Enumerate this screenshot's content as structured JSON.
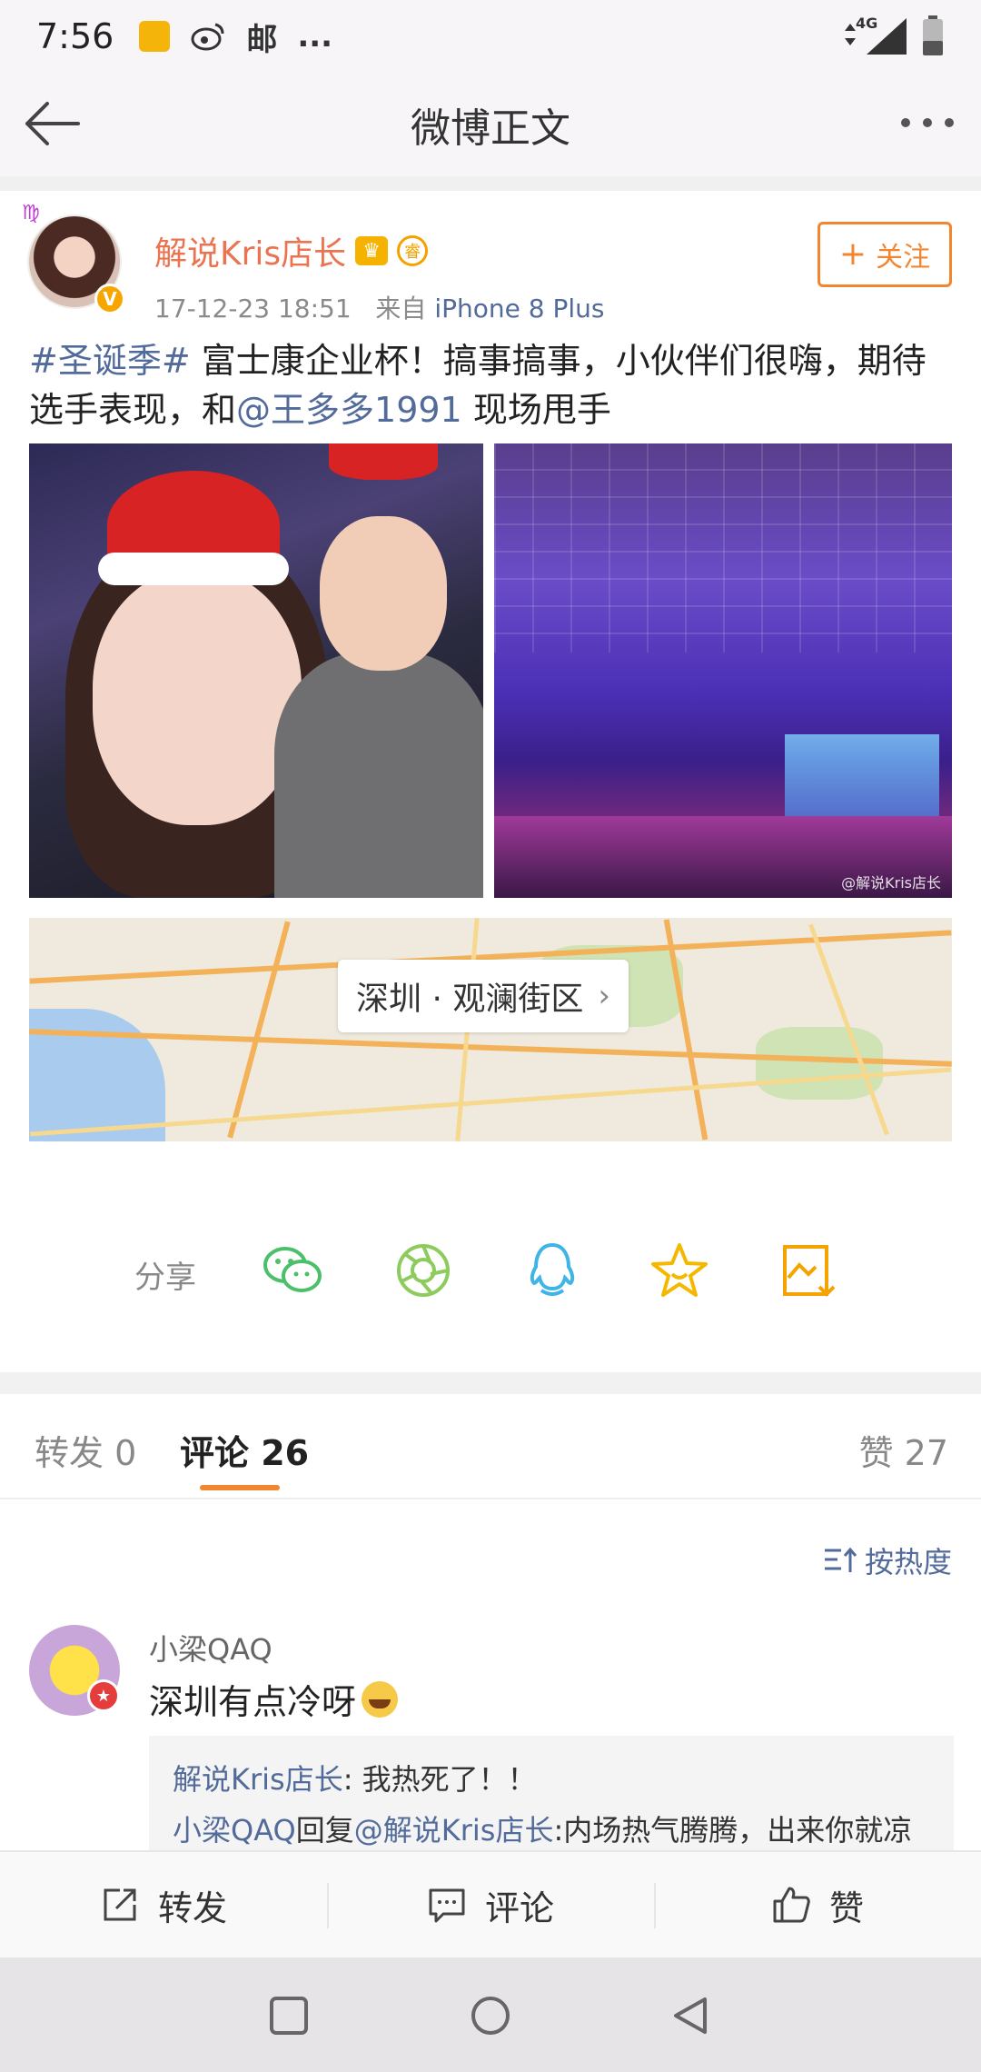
{
  "status_bar": {
    "time": "7:56",
    "network": "4G",
    "icons": [
      "gift-icon",
      "weibo-icon",
      "mail-icon",
      "more-notifications-icon"
    ],
    "more_glyph": "..."
  },
  "header": {
    "title": "微博正文"
  },
  "post": {
    "author": "解说Kris店长",
    "date": "17-12-23 18:51",
    "source_prefix": "来自",
    "source": "iPhone 8 Plus",
    "follow_label": "关注",
    "text_hashtag": "#圣诞季#",
    "text_part1": " 富士康企业杯！搞事搞事，小伙伴们很嗨，期待选手表现，和",
    "text_mention": "@王多多1991",
    "text_part2": " 现场甩手",
    "image2_watermark": "@解说Kris店长",
    "location": "深圳 · 观澜街区"
  },
  "share": {
    "label": "分享",
    "icons": [
      "wechat-icon",
      "moments-icon",
      "qq-icon",
      "favorite-icon",
      "save-image-icon"
    ]
  },
  "tabs": {
    "repost": "转发 0",
    "comments": "评论 26",
    "likes": "赞 27"
  },
  "sort_label": "按热度",
  "comment": {
    "user": "小梁QAQ",
    "text": "深圳有点冷呀",
    "reply1_user": "解说Kris店长",
    "reply1_text": ": 我热死了！！",
    "reply2_user": "小梁QAQ",
    "reply2_mid": "回复",
    "reply2_mention": "@解说Kris店长",
    "reply2_text": ":内场热气腾腾，出来你就凉"
  },
  "actions": {
    "repost": "转发",
    "comment": "评论",
    "like": "赞"
  },
  "colors": {
    "accent": "#f28630",
    "username": "#eb7350",
    "link": "#536b9a"
  }
}
